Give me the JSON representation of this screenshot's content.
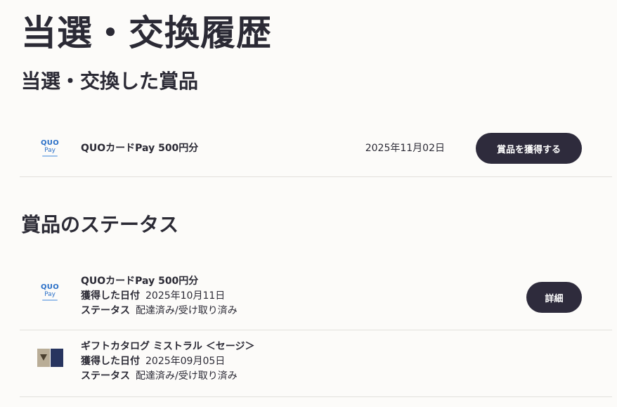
{
  "page_title": "当選・交換履歴",
  "prizes_section": {
    "title": "当選・交換した賞品",
    "items": [
      {
        "logo": {
          "quo": "QUO",
          "pay": "Pay",
          "icon": "quo-card-pay-logo-icon"
        },
        "name": "QUOカードPay 500円分",
        "date": "2025年11月02日",
        "button": "賞品を獲得する"
      }
    ]
  },
  "status_section": {
    "title": "賞品のステータス",
    "items": [
      {
        "logo": {
          "quo": "QUO",
          "pay": "Pay",
          "icon": "quo-card-pay-logo-icon"
        },
        "name": "QUOカードPay 500円分",
        "acquired_label": "獲得した日付",
        "acquired_date": "2025年10月11日",
        "status_label": "ステータス",
        "status_value": "配達済み/受け取り済み",
        "button": "詳細"
      },
      {
        "thumb_icon": "gift-catalog-thumbnail-icon",
        "name": "ギフトカタログ ミストラル ＜セージ＞",
        "acquired_label": "獲得した日付",
        "acquired_date": "2025年09月05日",
        "status_label": "ステータス",
        "status_value": "配達済み/受け取り済み"
      }
    ]
  },
  "colors": {
    "background": "#fcfbf9",
    "text": "#2b2a35",
    "button": "#2e2b3c",
    "quo_blue": "#2a6fc7",
    "divider": "#e2e0dc"
  }
}
